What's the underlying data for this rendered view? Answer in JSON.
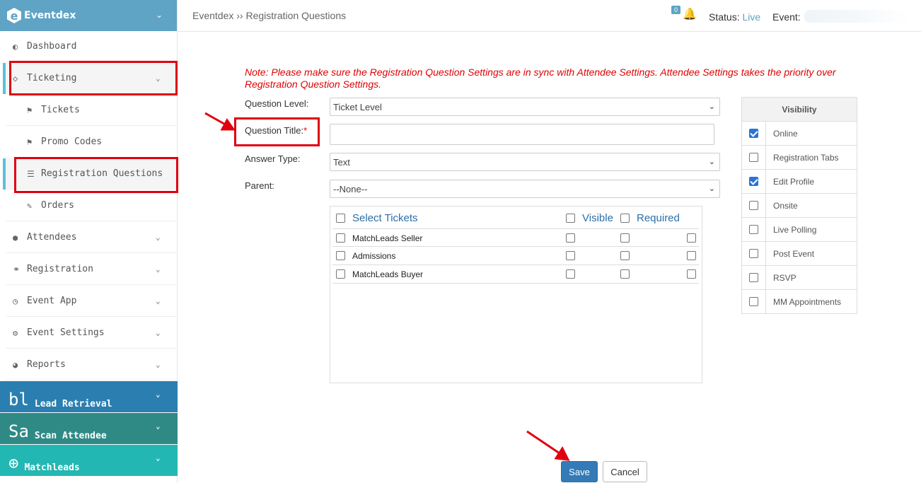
{
  "app": {
    "brand": "Eventdex"
  },
  "sidebar": {
    "items": [
      {
        "label": "Dashboard",
        "icon": "dashboard-icon"
      },
      {
        "label": "Ticketing",
        "icon": "ticket-icon"
      },
      {
        "label": "Tickets",
        "icon": "tags-icon"
      },
      {
        "label": "Promo Codes",
        "icon": "tags-icon"
      },
      {
        "label": "Registration Questions",
        "icon": "list-icon"
      },
      {
        "label": "Orders",
        "icon": "edit-icon"
      },
      {
        "label": "Attendees",
        "icon": "user-icon"
      },
      {
        "label": "Registration",
        "icon": "link-icon"
      },
      {
        "label": "Event App",
        "icon": "clock-icon"
      },
      {
        "label": "Event Settings",
        "icon": "gear-icon"
      },
      {
        "label": "Reports",
        "icon": "pie-chart-icon"
      }
    ],
    "products": [
      {
        "label": "Lead Retrieval",
        "mark": "bl",
        "color": "#2a7fb0"
      },
      {
        "label": "Scan Attendee",
        "mark": "Sa",
        "color": "#2f8a86"
      },
      {
        "label": "Matchleads",
        "mark": "⊕",
        "color": "#23b7b3"
      }
    ]
  },
  "header": {
    "breadcrumb": "Eventdex ›› Registration Questions",
    "notification_count": "0",
    "status_label": "Status:",
    "status_value": "Live",
    "event_label": "Event:"
  },
  "form": {
    "note": "Note: Please make sure the Registration Question Settings are in sync with Attendee Settings. Attendee Settings takes the priority over Registration Question Settings.",
    "question_level_label": "Question Level:",
    "question_level_value": "Ticket Level",
    "question_title_label": "Question Title:",
    "required_mark": "*",
    "answer_type_label": "Answer Type:",
    "answer_type_value": "Text",
    "parent_label": "Parent:",
    "parent_value": "--None--"
  },
  "tickets": {
    "headers": {
      "select": "Select Tickets",
      "visible": "Visible",
      "required": "Required"
    },
    "rows": [
      {
        "name": "MatchLeads Seller"
      },
      {
        "name": "Admissions"
      },
      {
        "name": "MatchLeads Buyer"
      }
    ]
  },
  "visibility": {
    "title": "Visibility",
    "options": [
      {
        "label": "Online",
        "checked": true
      },
      {
        "label": "Registration Tabs",
        "checked": false
      },
      {
        "label": "Edit Profile",
        "checked": true
      },
      {
        "label": "Onsite",
        "checked": false
      },
      {
        "label": "Live Polling",
        "checked": false
      },
      {
        "label": "Post Event",
        "checked": false
      },
      {
        "label": "RSVP",
        "checked": false
      },
      {
        "label": "MM Appointments",
        "checked": false
      }
    ]
  },
  "buttons": {
    "save": "Save",
    "cancel": "Cancel"
  },
  "colors": {
    "accent": "#5fa3c5",
    "highlight": "#e0000f",
    "primary": "#337ab7"
  }
}
